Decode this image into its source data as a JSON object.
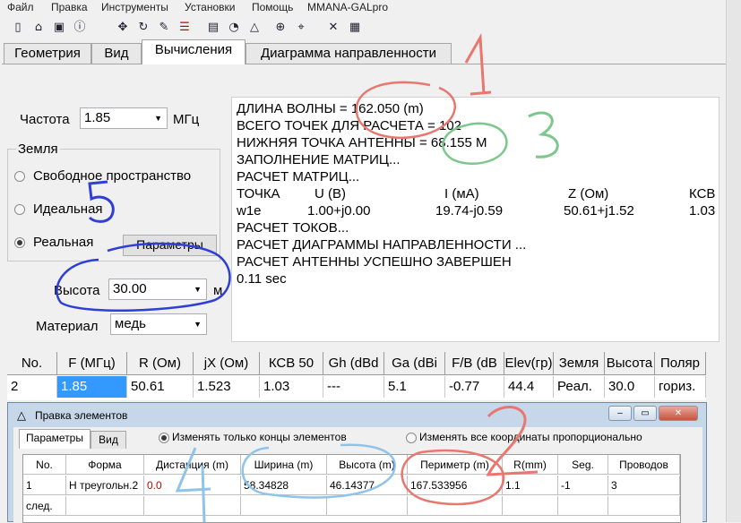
{
  "menu": {
    "items": [
      "Файл",
      "Правка",
      "Инструменты",
      "Установки",
      "Помощь",
      "MMANA-GALpro"
    ]
  },
  "toolbar": {
    "icons": [
      "new-file-icon",
      "open-folder-icon",
      "save-icon",
      "info-icon",
      "move-icon",
      "rotate-icon",
      "edit-element-icon",
      "list-icon",
      "document-icon",
      "chart-icon",
      "triangle-icon",
      "target-icon",
      "crosshair-icon",
      "tools-icon",
      "calculator-icon"
    ]
  },
  "tabs": [
    {
      "label": "Геометрия"
    },
    {
      "label": "Вид"
    },
    {
      "label": "Вычисления"
    },
    {
      "label": "Диаграмма направленности"
    }
  ],
  "calc": {
    "freq_label": "Частота",
    "freq_value": "1.85",
    "freq_unit": "МГц",
    "ground_group": "Земля",
    "ground_options": [
      "Свободное пространство",
      "Идеальная",
      "Реальная"
    ],
    "ground_selected": 2,
    "params_button": "Параметры",
    "height_label": "Высота",
    "height_value": "30.00",
    "height_unit": "м",
    "material_label": "Материал",
    "material_value": "медь"
  },
  "output": {
    "lines": [
      "ДЛИНА ВОЛНЫ = 162.050 (m)",
      "ВСЕГО ТОЧЕК ДЛЯ РАСЧЕТА = 102",
      "НИЖНЯЯ ТОЧКА АНТЕННЫ = 68.155 М",
      "ЗАПОЛНЕНИЕ МАТРИЦ...",
      "РАСЧЕТ МАТРИЦ...",
      "",
      "",
      "РАСЧЕТ ТОКОВ...",
      "РАСЧЕТ ДИАГРАММЫ НАПРАВЛЕННОСТИ ...",
      "РАСЧЕТ АНТЕННЫ УСПЕШНО ЗАВЕРШЕН",
      "0.11 sec"
    ],
    "table_header": [
      "ТОЧКА",
      "U (В)",
      "I (мА)",
      "Z (Ом)",
      "КСВ"
    ],
    "table_row": [
      "w1e",
      "1.00+j0.00",
      "19.74-j0.59",
      "50.61+j1.52",
      "1.03"
    ]
  },
  "results": {
    "headers": [
      "No.",
      "F (МГц)",
      "R (Ом)",
      "jX (Ом)",
      "КСВ 50",
      "Gh (dBd",
      "Ga (dBi",
      "F/B (dB",
      "Elev(гр)",
      "Земля",
      "Высота",
      "Поляр"
    ],
    "row": [
      "2",
      "1.85",
      "50.61",
      "1.523",
      "1.03",
      "---",
      "5.1",
      "-0.77",
      "44.4",
      "Реал.",
      "30.0",
      "гориз."
    ]
  },
  "dialog": {
    "title": "Правка элементов",
    "tabs": [
      "Параметры",
      "Вид"
    ],
    "radio_options": [
      "Изменять только концы элементов",
      "Изменять все координаты пропорционально"
    ],
    "radio_selected": 0,
    "headers": [
      "No.",
      "Форма",
      "Дистанция (m)",
      "Ширина (m)",
      "Высота (m)",
      "Периметр (m)",
      "R(mm)",
      "Seg.",
      "Проводов"
    ],
    "row": [
      "1",
      "Н треугольн.2",
      "0.0",
      "58.34828",
      "46.14377",
      "167.533956",
      "1.1",
      "-1",
      "3"
    ],
    "next_label": "след.",
    "window_buttons": [
      "–",
      "▭",
      "✕"
    ]
  },
  "annotations": {
    "marks": [
      "1",
      "2",
      "3",
      "4",
      "5"
    ],
    "colors": {
      "red": "#e8776f",
      "green": "#7cc78c",
      "blue": "#2f3fd6",
      "lightblue": "#8fc3ea"
    }
  },
  "colors": {
    "selection": "#3399ff",
    "dialog_frame": "#c6d7ea",
    "distance_value": "#cc0000"
  }
}
